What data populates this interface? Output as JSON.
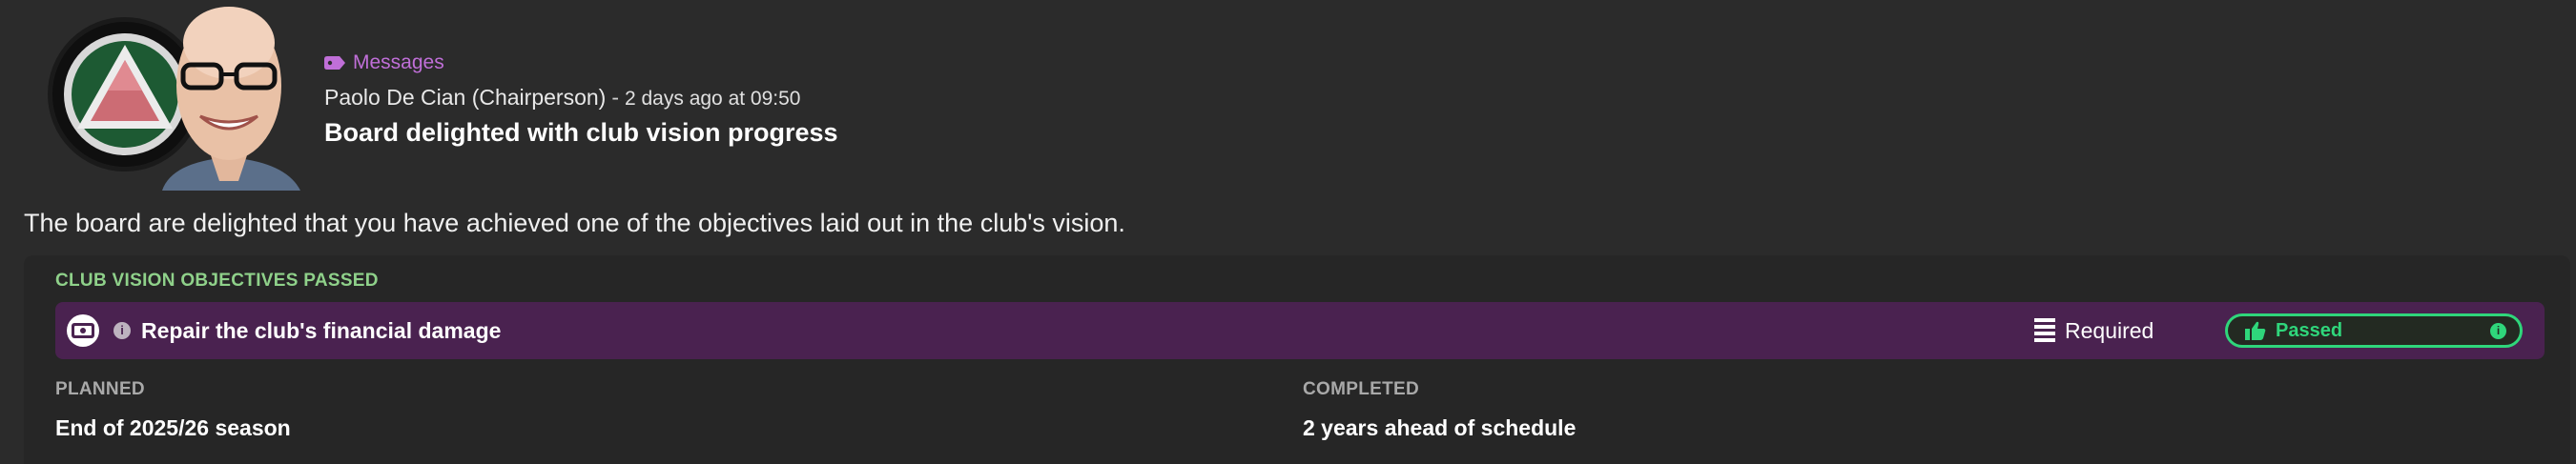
{
  "header": {
    "category_label": "Messages",
    "sender": "Paolo De Cian (Chairperson)",
    "separator": "-",
    "time": "2 days ago at 09:50",
    "subject": "Board delighted with club vision progress"
  },
  "body": {
    "text": "The board are delighted that you have achieved one of the objectives laid out in the club's vision."
  },
  "panel": {
    "title": "CLUB VISION OBJECTIVES PASSED",
    "objective": {
      "label": "Repair the club's financial damage",
      "info_glyph": "i",
      "importance": "Required",
      "status": "Passed",
      "status_info_glyph": "i"
    },
    "planned_label": "PLANNED",
    "planned_value": "End of 2025/26 season",
    "completed_label": "COMPLETED",
    "completed_value": "2 years ahead of schedule"
  },
  "colors": {
    "background": "#2b2b2b",
    "panel": "#262626",
    "objective_row": "#4a2250",
    "accent_green": "#2fd67b",
    "title_green": "#8fd18a",
    "messages_purple": "#c06fd8"
  },
  "icons": {
    "category": "tag-icon",
    "objective": "finance-icon",
    "info": "info-icon",
    "importance": "list-icon",
    "status": "thumbs-up-icon"
  }
}
